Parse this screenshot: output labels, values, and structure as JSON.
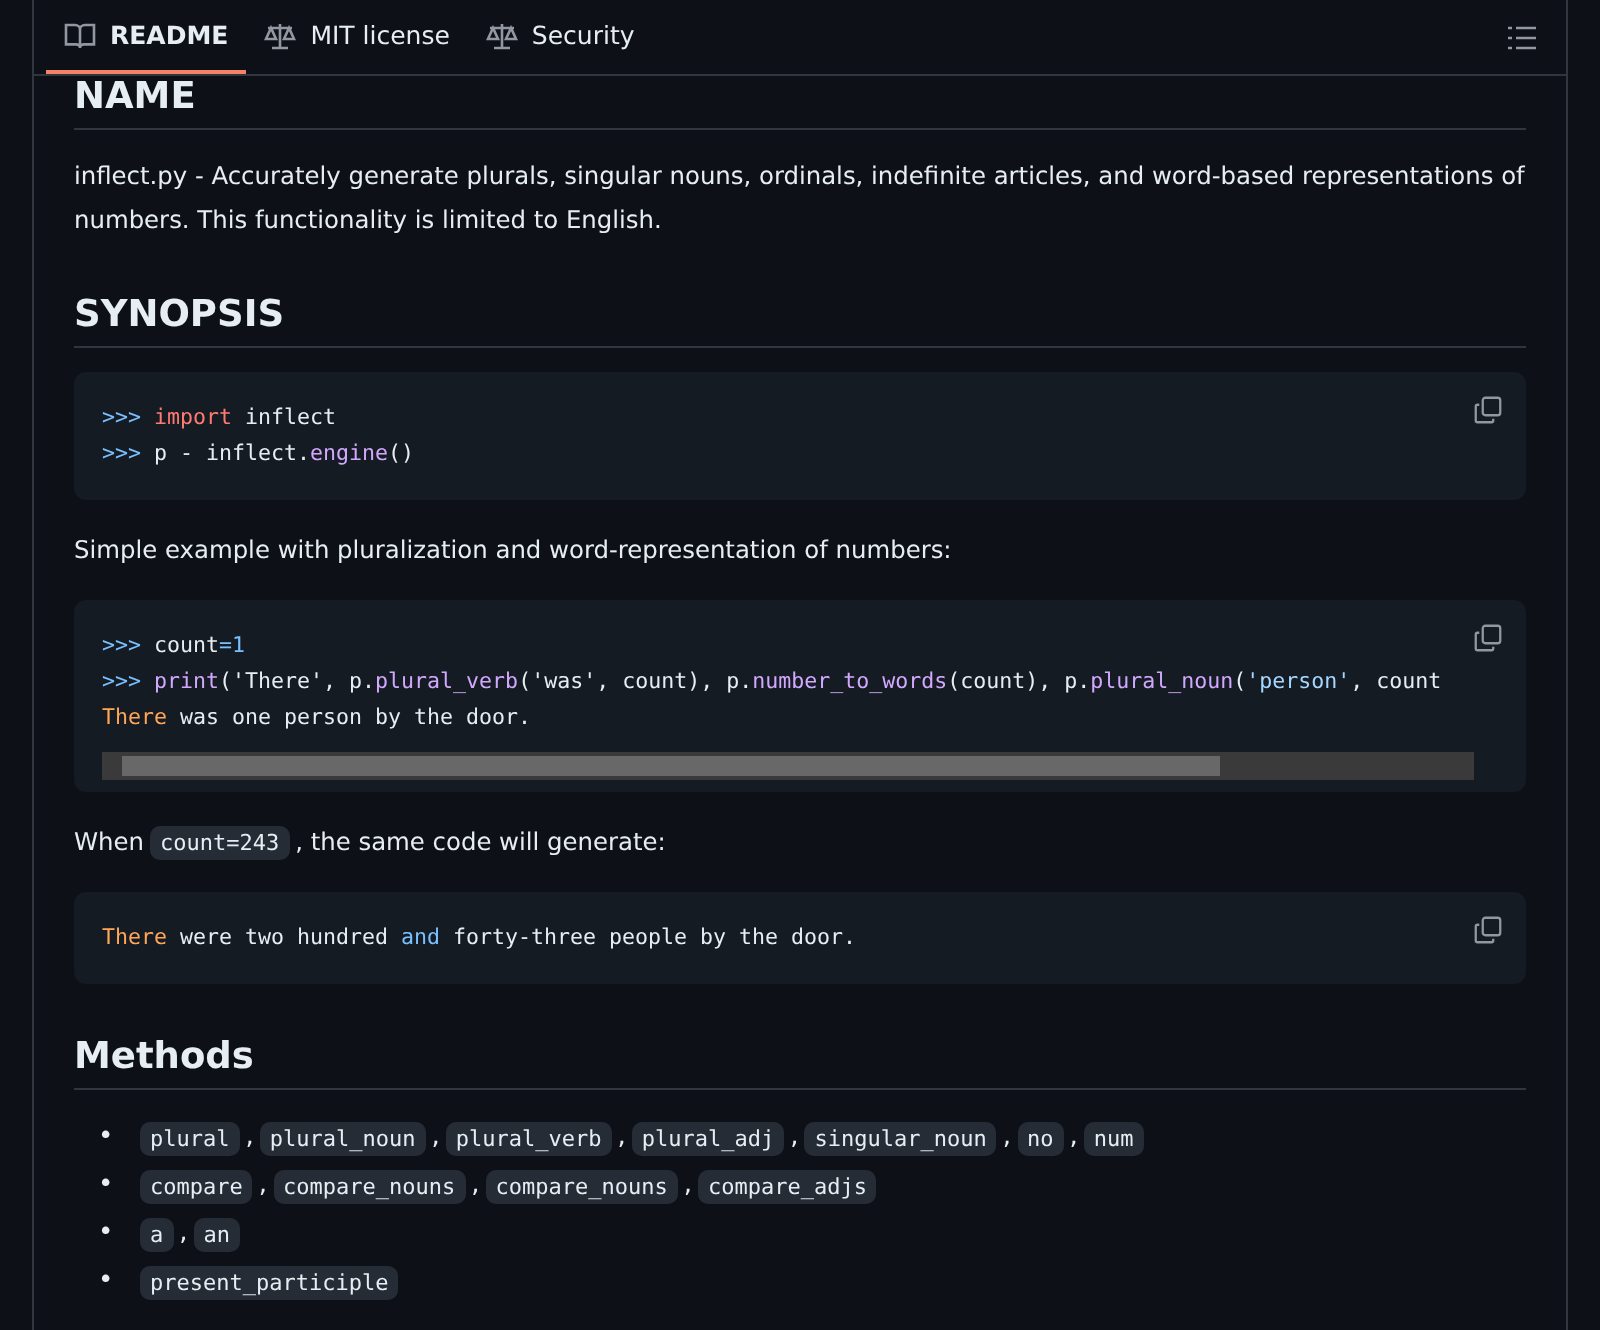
{
  "tabs": [
    {
      "label": "README",
      "selected": true
    },
    {
      "label": "MIT license",
      "selected": false
    },
    {
      "label": "Security",
      "selected": false
    }
  ],
  "content": [
    {
      "kind": "heading",
      "text": "NAME"
    },
    {
      "kind": "paragraph",
      "parts": [
        {
          "kind": "text",
          "text": "inflect.py - Accurately generate plurals, singular nouns, ordinals, indefinite articles, and word-based representations of numbers. This functionality is limited to English."
        }
      ]
    },
    {
      "kind": "heading",
      "text": "SYNOPSIS"
    },
    {
      "kind": "code",
      "scrollbar": false,
      "lines": [
        [
          {
            "t": ">>> ",
            "color": "#79c0ff"
          },
          {
            "t": "import",
            "color": "#ff7b72"
          },
          {
            "t": " inflect",
            "color": "#e6edf3"
          }
        ],
        [
          {
            "t": ">>> ",
            "color": "#79c0ff"
          },
          {
            "t": "p - inflect.",
            "color": "#e6edf3"
          },
          {
            "t": "engine",
            "color": "#d2a8ff"
          },
          {
            "t": "()",
            "color": "#e6edf3"
          }
        ]
      ]
    },
    {
      "kind": "paragraph",
      "parts": [
        {
          "kind": "text",
          "text": "Simple example with pluralization and word-representation of numbers:"
        }
      ]
    },
    {
      "kind": "code",
      "scrollbar": true,
      "lines": [
        [
          {
            "t": ">>> ",
            "color": "#79c0ff"
          },
          {
            "t": "count",
            "color": "#e6edf3"
          },
          {
            "t": "=1",
            "color": "#79c0ff"
          }
        ],
        [
          {
            "t": ">>> ",
            "color": "#79c0ff"
          },
          {
            "t": "print",
            "color": "#d2a8ff"
          },
          {
            "t": "('There', p.",
            "color": "#e6edf3"
          },
          {
            "t": "plural_verb",
            "color": "#d2a8ff"
          },
          {
            "t": "('was', count), p.",
            "color": "#e6edf3"
          },
          {
            "t": "number_to_words",
            "color": "#d2a8ff"
          },
          {
            "t": "(count), p.",
            "color": "#e6edf3"
          },
          {
            "t": "plural_noun",
            "color": "#d2a8ff"
          },
          {
            "t": "(",
            "color": "#e6edf3"
          },
          {
            "t": "'person'",
            "color": "#a5d6ff"
          },
          {
            "t": ", count",
            "color": "#e6edf3"
          }
        ],
        [
          {
            "t": "There",
            "color": "#ffa657"
          },
          {
            "t": " was one person by the door.",
            "color": "#e6edf3"
          }
        ]
      ]
    },
    {
      "kind": "paragraph",
      "parts": [
        {
          "kind": "text",
          "text": "When"
        },
        {
          "kind": "code",
          "text": "count=243"
        },
        {
          "kind": "text",
          "text": ", the same code will generate:"
        }
      ]
    },
    {
      "kind": "code",
      "scrollbar": false,
      "lines": [
        [
          {
            "t": "There",
            "color": "#ffa657"
          },
          {
            "t": " were two hundred ",
            "color": "#e6edf3"
          },
          {
            "t": "and",
            "color": "#79c0ff"
          },
          {
            "t": " forty-three people by the door.",
            "color": "#e6edf3"
          }
        ]
      ]
    },
    {
      "kind": "heading",
      "text": "Methods"
    },
    {
      "kind": "list",
      "items": [
        {
          "marker": "•",
          "parts": [
            {
              "kind": "code",
              "text": "plural"
            },
            {
              "kind": "text",
              "text": ","
            },
            {
              "kind": "code",
              "text": "plural_noun"
            },
            {
              "kind": "text",
              "text": ","
            },
            {
              "kind": "code",
              "text": "plural_verb"
            },
            {
              "kind": "text",
              "text": ","
            },
            {
              "kind": "code",
              "text": "plural_adj"
            },
            {
              "kind": "text",
              "text": ","
            },
            {
              "kind": "code",
              "text": "singular_noun"
            },
            {
              "kind": "text",
              "text": ","
            },
            {
              "kind": "code",
              "text": "no"
            },
            {
              "kind": "text",
              "text": ","
            },
            {
              "kind": "code",
              "text": "num"
            }
          ]
        },
        {
          "marker": "•",
          "parts": [
            {
              "kind": "code",
              "text": "compare"
            },
            {
              "kind": "text",
              "text": ","
            },
            {
              "kind": "code",
              "text": "compare_nouns"
            },
            {
              "kind": "text",
              "text": ","
            },
            {
              "kind": "code",
              "text": "compare_nouns"
            },
            {
              "kind": "text",
              "text": ","
            },
            {
              "kind": "code",
              "text": "compare_adjs"
            }
          ]
        },
        {
          "marker": "•",
          "parts": [
            {
              "kind": "code",
              "text": "a"
            },
            {
              "kind": "text",
              "text": ","
            },
            {
              "kind": "code",
              "text": "an"
            }
          ]
        },
        {
          "marker": "•",
          "parts": [
            {
              "kind": "code",
              "text": "present_participle"
            }
          ]
        }
      ]
    }
  ]
}
